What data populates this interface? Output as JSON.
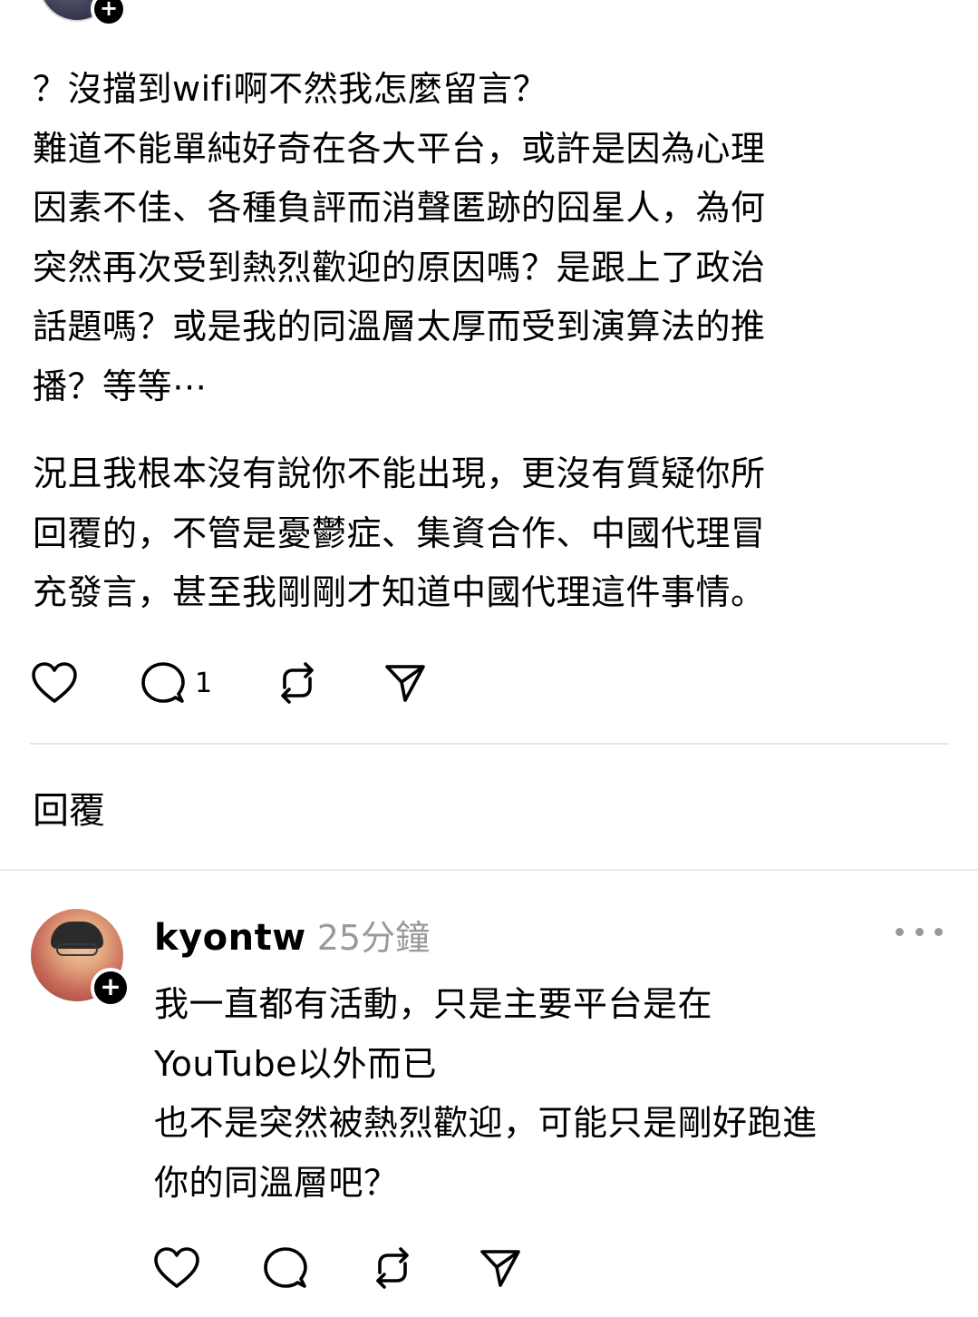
{
  "post": {
    "paragraphs": [
      {
        "lines": [
          "？沒擋到wifi啊不然我怎麼留言？",
          "難道不能單純好奇在各大平台，或許是因為心理",
          "因素不佳、各種負評而消聲匿跡的囧星人，為何",
          "突然再次受到熱烈歡迎的原因嗎？是跟上了政治",
          "話題嗎？或是我的同溫層太厚而受到演算法的推",
          "播？等等⋯"
        ]
      },
      {
        "lines": [
          "況且我根本沒有說你不能出現，更沒有質疑你所",
          "回覆的，不管是憂鬱症、集資合作、中國代理冒",
          "充發言，甚至我剛剛才知道中國代理這件事情。"
        ]
      }
    ],
    "actions": {
      "like_icon": "heart-icon",
      "reply_icon": "comment-icon",
      "reply_count": "1",
      "repost_icon": "repost-icon",
      "share_icon": "send-icon"
    }
  },
  "replies_section": {
    "label": "回覆"
  },
  "reply": {
    "username": "kyontw",
    "timestamp": "25分鐘",
    "lines": [
      "我一直都有活動，只是主要平台是在",
      "YouTube以外而已",
      "也不是突然被熱烈歡迎，可能只是剛好跑進",
      "你的同溫層吧？"
    ],
    "more_icon": "more-horizontal-icon",
    "follow_icon": "plus-icon",
    "actions": {
      "like_icon": "heart-icon",
      "reply_icon": "comment-icon",
      "repost_icon": "repost-icon",
      "share_icon": "send-icon"
    }
  },
  "colors": {
    "text": "#000000",
    "muted": "#999999",
    "divider": "#e6e6e6",
    "background": "#ffffff"
  }
}
